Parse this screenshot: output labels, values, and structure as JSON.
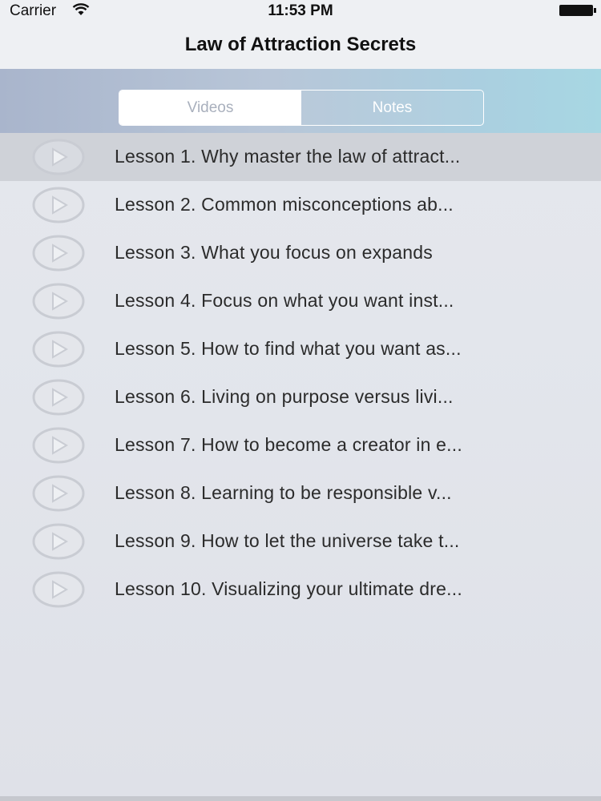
{
  "status_bar": {
    "carrier": "Carrier",
    "time": "11:53 PM"
  },
  "nav": {
    "title": "Law of Attraction Secrets"
  },
  "segments": {
    "videos": "Videos",
    "notes": "Notes",
    "selected": "Videos"
  },
  "lessons": [
    {
      "label": "Lesson 1. Why master the law of attract...",
      "highlighted": true
    },
    {
      "label": "Lesson 2. Common misconceptions ab..."
    },
    {
      "label": "Lesson 3. What you focus on expands"
    },
    {
      "label": "Lesson 4. Focus on what you want inst..."
    },
    {
      "label": "Lesson 5. How to find what you want as..."
    },
    {
      "label": "Lesson 6. Living on purpose versus livi..."
    },
    {
      "label": "Lesson 7. How to become a creator in e..."
    },
    {
      "label": "Lesson 8. Learning to be responsible v..."
    },
    {
      "label": "Lesson 9. How to let the universe take t..."
    },
    {
      "label": "Lesson 10. Visualizing your ultimate dre..."
    }
  ],
  "icons": {
    "row_icon": "play-circle-icon",
    "wifi": "wifi-icon",
    "battery": "battery-icon"
  }
}
